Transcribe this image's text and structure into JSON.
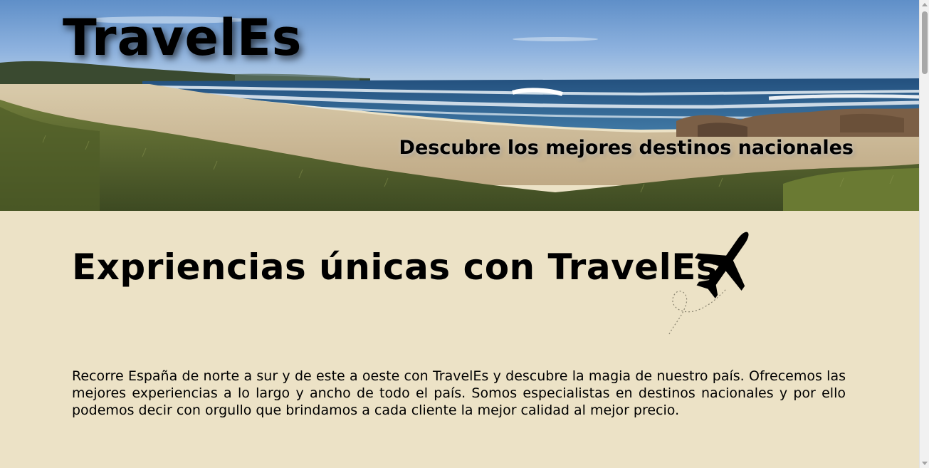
{
  "header": {
    "brand": "TravelEs",
    "tagline": "Descubre los mejores destinos nacionales",
    "banner_image": "beach-coast-banner"
  },
  "main": {
    "heading": "Expriencias únicas con TravelEs",
    "decoration_icon": "airplane-dotted-trail-icon",
    "intro": "Recorre España de norte a sur y de este a oeste con TravelEs y descubre la magia de nuestro país. Ofrecemos las mejores experiencias a lo largo y ancho de todo el país. Somos especialistas en destinos nacionales y por ello podemos decir con orgullo que brindamos a cada cliente la mejor calidad al mejor precio."
  },
  "colors": {
    "page_background": "#ece2c6",
    "text": "#000000",
    "sky": "#7fa6d6",
    "sea": "#2f5f8c",
    "sand": "#cdbb98",
    "grass": "#5b6b2e"
  }
}
